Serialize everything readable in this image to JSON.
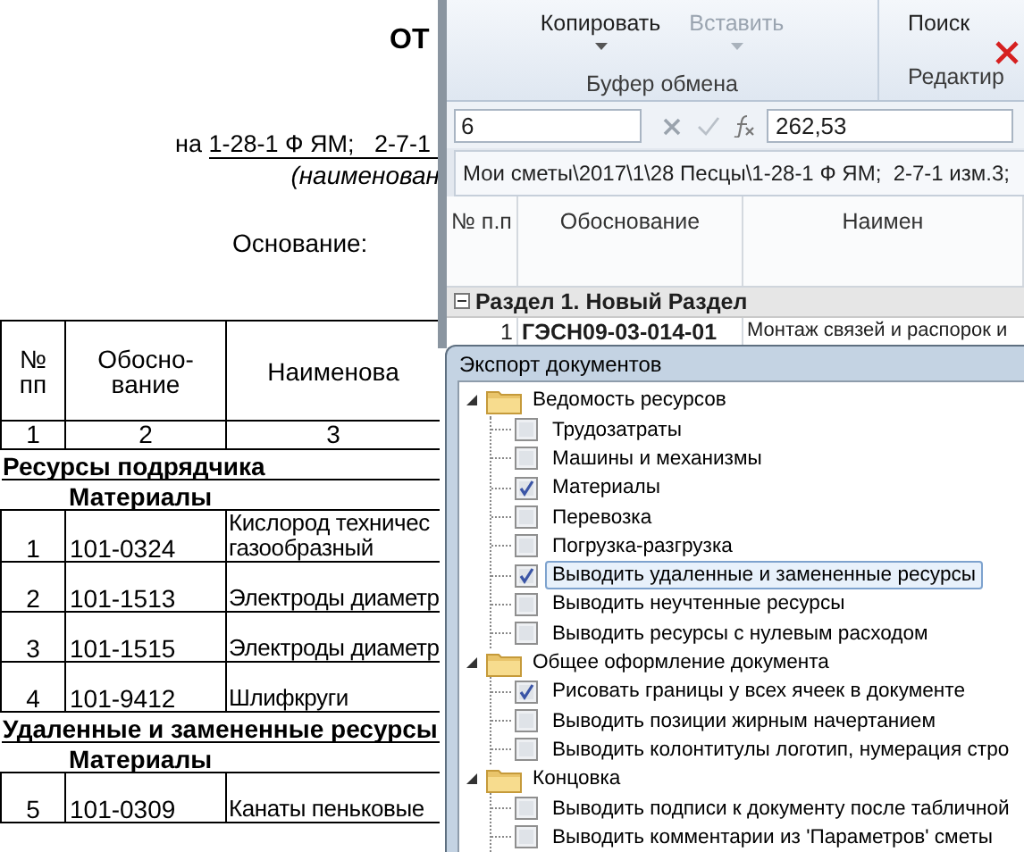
{
  "document": {
    "title": "ОТ",
    "subject_prefix": "на",
    "subject": "1-28-1 Ф ЯМ;   2-7-1",
    "subject_caption": "(наименован",
    "basis_label": "Основание:",
    "columns": [
      "№ пп",
      "Обосно-вание",
      "Наименова"
    ],
    "column_numbers": [
      "1",
      "2",
      "3"
    ],
    "rows": [
      {
        "kind": "section",
        "text": "Ресурсы подрядчика"
      },
      {
        "kind": "group",
        "text": "Материалы"
      },
      {
        "kind": "item",
        "number": "1",
        "code": "101-0324",
        "name": "Кислород техничес\nгазообразный"
      },
      {
        "kind": "item",
        "number": "2",
        "code": "101-1513",
        "name": "Электроды диаметр"
      },
      {
        "kind": "item",
        "number": "3",
        "code": "101-1515",
        "name": "Электроды диаметр"
      },
      {
        "kind": "item",
        "number": "4",
        "code": "101-9412",
        "name": "Шлифкруги"
      },
      {
        "kind": "section",
        "text": "Удаленные и замененные ресурсы"
      },
      {
        "kind": "group",
        "text": "Материалы"
      },
      {
        "kind": "item",
        "number": "5",
        "code": "101-0309",
        "name": "Канаты пеньковые"
      }
    ]
  },
  "app": {
    "ribbon": [
      {
        "label": "Буфер обмена",
        "buttons": [
          {
            "label": "Копировать",
            "disabled": false,
            "dropdown": true
          },
          {
            "label": "Вставить",
            "disabled": true,
            "dropdown": true
          }
        ]
      },
      {
        "label": "Редактир",
        "buttons": [
          {
            "label": "Поиск",
            "disabled": false,
            "dropdown": false
          }
        ]
      }
    ],
    "name_box": "6",
    "formula_value": "262,53",
    "path": "Мои сметы\\2017\\1\\28 Песцы\\1-28-1 Ф ЯМ;  2-7-1 изм.3;",
    "columns": [
      "№ п.п",
      "Обоснование",
      "Наимен"
    ],
    "section": {
      "title": "Раздел 1. Новый Раздел",
      "expanded": true
    },
    "rows": [
      {
        "number": "1",
        "code": "ГЭСН09-03-014-01",
        "name": "Монтаж связей и распорок и"
      }
    ]
  },
  "dialog": {
    "title": "Экспорт документов",
    "tree": [
      {
        "label": "Ведомость ресурсов",
        "expanded": true,
        "children": [
          {
            "label": "Трудозатраты",
            "checked": false,
            "selected": false
          },
          {
            "label": "Машины и механизмы",
            "checked": false,
            "selected": false
          },
          {
            "label": "Материалы",
            "checked": true,
            "selected": false
          },
          {
            "label": "Перевозка",
            "checked": false,
            "selected": false
          },
          {
            "label": "Погрузка-разгрузка",
            "checked": false,
            "selected": false
          },
          {
            "label": "Выводить удаленные и замененные ресурсы",
            "checked": true,
            "selected": true
          },
          {
            "label": "Выводить неучтенные ресурсы",
            "checked": false,
            "selected": false
          },
          {
            "label": "Выводить ресурсы с нулевым расходом",
            "checked": false,
            "selected": false
          }
        ]
      },
      {
        "label": "Общее оформление документа",
        "expanded": true,
        "children": [
          {
            "label": "Рисовать границы у всех ячеек в документе",
            "checked": true,
            "selected": false
          },
          {
            "label": "Выводить позиции жирным начертанием",
            "checked": false,
            "selected": false
          },
          {
            "label": "Выводить колонтитулы логотип, нумерация стро",
            "checked": false,
            "selected": false
          }
        ]
      },
      {
        "label": "Концовка",
        "expanded": true,
        "children": [
          {
            "label": "Выводить подписи к документу после табличной",
            "checked": false,
            "selected": false
          },
          {
            "label": "Выводить комментарии из 'Параметров' сметы",
            "checked": false,
            "selected": false
          }
        ]
      }
    ]
  }
}
